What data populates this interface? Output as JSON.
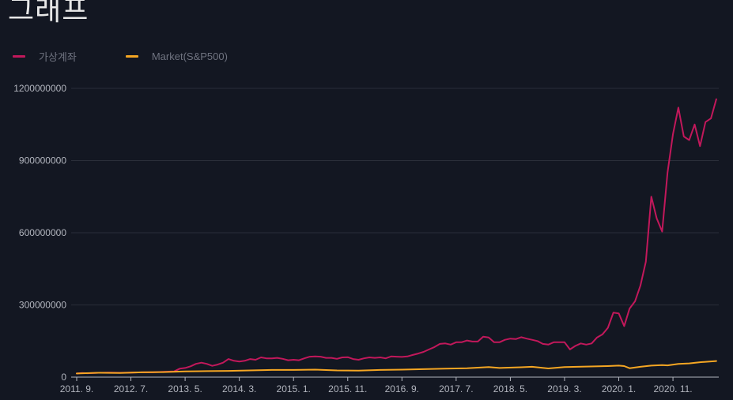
{
  "header": {
    "title": "그래프"
  },
  "colors": {
    "background": "#131722",
    "grid": "#2a2e39",
    "axis": "#b2b5be"
  },
  "chart_data": {
    "type": "line",
    "legend_position": "top-left",
    "grid": true,
    "ylim": [
      0,
      1200000000
    ],
    "y_ticks": [
      0,
      300000000,
      600000000,
      900000000,
      1200000000
    ],
    "y_tick_labels": [
      "0",
      "300000000",
      "600000000",
      "900000000",
      "1200000000"
    ],
    "x_range": [
      "2011-09",
      "2021-07"
    ],
    "x_ticks": [
      {
        "date": "2011-09",
        "label": "2011. 9."
      },
      {
        "date": "2012-07",
        "label": "2012. 7."
      },
      {
        "date": "2013-05",
        "label": "2013. 5."
      },
      {
        "date": "2014-03",
        "label": "2014. 3."
      },
      {
        "date": "2015-01",
        "label": "2015. 1."
      },
      {
        "date": "2015-11",
        "label": "2015. 11."
      },
      {
        "date": "2016-09",
        "label": "2016. 9."
      },
      {
        "date": "2017-07",
        "label": "2017. 7."
      },
      {
        "date": "2018-05",
        "label": "2018. 5."
      },
      {
        "date": "2019-03",
        "label": "2019. 3."
      },
      {
        "date": "2020-01",
        "label": "2020. 1."
      },
      {
        "date": "2020-11",
        "label": "2020. 11."
      }
    ],
    "series": [
      {
        "name": "가상계좌",
        "color": "#c2185b",
        "points": [
          {
            "x": "2011-09",
            "y": 15000000
          },
          {
            "x": "2011-10",
            "y": 17000000
          },
          {
            "x": "2011-11",
            "y": 16000000
          },
          {
            "x": "2012-01",
            "y": 18000000
          },
          {
            "x": "2012-03",
            "y": 19000000
          },
          {
            "x": "2012-05",
            "y": 18000000
          },
          {
            "x": "2012-07",
            "y": 19000000
          },
          {
            "x": "2012-09",
            "y": 20000000
          },
          {
            "x": "2012-11",
            "y": 20000000
          },
          {
            "x": "2013-01",
            "y": 22000000
          },
          {
            "x": "2013-03",
            "y": 24000000
          },
          {
            "x": "2013-04",
            "y": 35000000
          },
          {
            "x": "2013-05",
            "y": 38000000
          },
          {
            "x": "2013-06",
            "y": 45000000
          },
          {
            "x": "2013-07",
            "y": 55000000
          },
          {
            "x": "2013-08",
            "y": 60000000
          },
          {
            "x": "2013-09",
            "y": 55000000
          },
          {
            "x": "2013-10",
            "y": 47000000
          },
          {
            "x": "2013-11",
            "y": 52000000
          },
          {
            "x": "2013-12",
            "y": 60000000
          },
          {
            "x": "2014-01",
            "y": 75000000
          },
          {
            "x": "2014-02",
            "y": 68000000
          },
          {
            "x": "2014-03",
            "y": 65000000
          },
          {
            "x": "2014-04",
            "y": 68000000
          },
          {
            "x": "2014-05",
            "y": 75000000
          },
          {
            "x": "2014-06",
            "y": 72000000
          },
          {
            "x": "2014-07",
            "y": 82000000
          },
          {
            "x": "2014-08",
            "y": 78000000
          },
          {
            "x": "2014-09",
            "y": 78000000
          },
          {
            "x": "2014-10",
            "y": 80000000
          },
          {
            "x": "2014-11",
            "y": 76000000
          },
          {
            "x": "2014-12",
            "y": 70000000
          },
          {
            "x": "2015-01",
            "y": 72000000
          },
          {
            "x": "2015-02",
            "y": 70000000
          },
          {
            "x": "2015-03",
            "y": 78000000
          },
          {
            "x": "2015-04",
            "y": 85000000
          },
          {
            "x": "2015-05",
            "y": 86000000
          },
          {
            "x": "2015-06",
            "y": 85000000
          },
          {
            "x": "2015-07",
            "y": 80000000
          },
          {
            "x": "2015-08",
            "y": 80000000
          },
          {
            "x": "2015-09",
            "y": 76000000
          },
          {
            "x": "2015-10",
            "y": 82000000
          },
          {
            "x": "2015-11",
            "y": 83000000
          },
          {
            "x": "2015-12",
            "y": 75000000
          },
          {
            "x": "2016-01",
            "y": 72000000
          },
          {
            "x": "2016-02",
            "y": 78000000
          },
          {
            "x": "2016-03",
            "y": 82000000
          },
          {
            "x": "2016-04",
            "y": 80000000
          },
          {
            "x": "2016-05",
            "y": 82000000
          },
          {
            "x": "2016-06",
            "y": 78000000
          },
          {
            "x": "2016-07",
            "y": 86000000
          },
          {
            "x": "2016-08",
            "y": 85000000
          },
          {
            "x": "2016-09",
            "y": 84000000
          },
          {
            "x": "2016-10",
            "y": 86000000
          },
          {
            "x": "2016-11",
            "y": 92000000
          },
          {
            "x": "2016-12",
            "y": 98000000
          },
          {
            "x": "2017-01",
            "y": 105000000
          },
          {
            "x": "2017-02",
            "y": 115000000
          },
          {
            "x": "2017-03",
            "y": 125000000
          },
          {
            "x": "2017-04",
            "y": 138000000
          },
          {
            "x": "2017-05",
            "y": 140000000
          },
          {
            "x": "2017-06",
            "y": 135000000
          },
          {
            "x": "2017-07",
            "y": 145000000
          },
          {
            "x": "2017-08",
            "y": 145000000
          },
          {
            "x": "2017-09",
            "y": 152000000
          },
          {
            "x": "2017-10",
            "y": 148000000
          },
          {
            "x": "2017-11",
            "y": 148000000
          },
          {
            "x": "2017-12",
            "y": 168000000
          },
          {
            "x": "2018-01",
            "y": 165000000
          },
          {
            "x": "2018-02",
            "y": 145000000
          },
          {
            "x": "2018-03",
            "y": 145000000
          },
          {
            "x": "2018-04",
            "y": 155000000
          },
          {
            "x": "2018-05",
            "y": 160000000
          },
          {
            "x": "2018-06",
            "y": 158000000
          },
          {
            "x": "2018-07",
            "y": 166000000
          },
          {
            "x": "2018-08",
            "y": 160000000
          },
          {
            "x": "2018-09",
            "y": 155000000
          },
          {
            "x": "2018-10",
            "y": 150000000
          },
          {
            "x": "2018-11",
            "y": 138000000
          },
          {
            "x": "2018-12",
            "y": 135000000
          },
          {
            "x": "2019-01",
            "y": 145000000
          },
          {
            "x": "2019-02",
            "y": 145000000
          },
          {
            "x": "2019-03",
            "y": 145000000
          },
          {
            "x": "2019-04",
            "y": 115000000
          },
          {
            "x": "2019-05",
            "y": 130000000
          },
          {
            "x": "2019-06",
            "y": 140000000
          },
          {
            "x": "2019-07",
            "y": 135000000
          },
          {
            "x": "2019-08",
            "y": 140000000
          },
          {
            "x": "2019-09",
            "y": 165000000
          },
          {
            "x": "2019-10",
            "y": 178000000
          },
          {
            "x": "2019-11",
            "y": 205000000
          },
          {
            "x": "2019-12",
            "y": 268000000
          },
          {
            "x": "2020-01",
            "y": 265000000
          },
          {
            "x": "2020-02",
            "y": 212000000
          },
          {
            "x": "2020-03",
            "y": 285000000
          },
          {
            "x": "2020-04",
            "y": 315000000
          },
          {
            "x": "2020-05",
            "y": 380000000
          },
          {
            "x": "2020-06",
            "y": 480000000
          },
          {
            "x": "2020-07",
            "y": 750000000
          },
          {
            "x": "2020-08",
            "y": 660000000
          },
          {
            "x": "2020-09",
            "y": 605000000
          },
          {
            "x": "2020-10",
            "y": 850000000
          },
          {
            "x": "2020-11",
            "y": 1010000000
          },
          {
            "x": "2020-12",
            "y": 1120000000
          },
          {
            "x": "2021-01",
            "y": 1000000000
          },
          {
            "x": "2021-02",
            "y": 985000000
          },
          {
            "x": "2021-03",
            "y": 1050000000
          },
          {
            "x": "2021-04",
            "y": 960000000
          },
          {
            "x": "2021-05",
            "y": 1060000000
          },
          {
            "x": "2021-06",
            "y": 1075000000
          },
          {
            "x": "2021-07",
            "y": 1155000000
          }
        ]
      },
      {
        "name": "Market(S&P500)",
        "color": "#f5a623",
        "points": [
          {
            "x": "2011-09",
            "y": 15000000
          },
          {
            "x": "2012-01",
            "y": 18000000
          },
          {
            "x": "2012-05",
            "y": 17000000
          },
          {
            "x": "2012-09",
            "y": 20000000
          },
          {
            "x": "2013-01",
            "y": 21000000
          },
          {
            "x": "2013-05",
            "y": 24000000
          },
          {
            "x": "2013-09",
            "y": 25000000
          },
          {
            "x": "2014-01",
            "y": 26000000
          },
          {
            "x": "2014-05",
            "y": 28000000
          },
          {
            "x": "2014-09",
            "y": 30000000
          },
          {
            "x": "2015-01",
            "y": 30000000
          },
          {
            "x": "2015-05",
            "y": 31000000
          },
          {
            "x": "2015-09",
            "y": 28000000
          },
          {
            "x": "2016-01",
            "y": 27000000
          },
          {
            "x": "2016-05",
            "y": 30000000
          },
          {
            "x": "2016-09",
            "y": 31000000
          },
          {
            "x": "2017-01",
            "y": 33000000
          },
          {
            "x": "2017-05",
            "y": 35000000
          },
          {
            "x": "2017-09",
            "y": 37000000
          },
          {
            "x": "2018-01",
            "y": 42000000
          },
          {
            "x": "2018-03",
            "y": 38000000
          },
          {
            "x": "2018-07",
            "y": 41000000
          },
          {
            "x": "2018-09",
            "y": 43000000
          },
          {
            "x": "2018-12",
            "y": 36000000
          },
          {
            "x": "2019-03",
            "y": 42000000
          },
          {
            "x": "2019-07",
            "y": 44000000
          },
          {
            "x": "2019-11",
            "y": 46000000
          },
          {
            "x": "2020-01",
            "y": 48000000
          },
          {
            "x": "2020-02",
            "y": 46000000
          },
          {
            "x": "2020-03",
            "y": 37000000
          },
          {
            "x": "2020-05",
            "y": 43000000
          },
          {
            "x": "2020-07",
            "y": 48000000
          },
          {
            "x": "2020-09",
            "y": 50000000
          },
          {
            "x": "2020-10",
            "y": 49000000
          },
          {
            "x": "2020-12",
            "y": 55000000
          },
          {
            "x": "2021-02",
            "y": 57000000
          },
          {
            "x": "2021-04",
            "y": 62000000
          },
          {
            "x": "2021-07",
            "y": 67000000
          }
        ]
      }
    ]
  }
}
